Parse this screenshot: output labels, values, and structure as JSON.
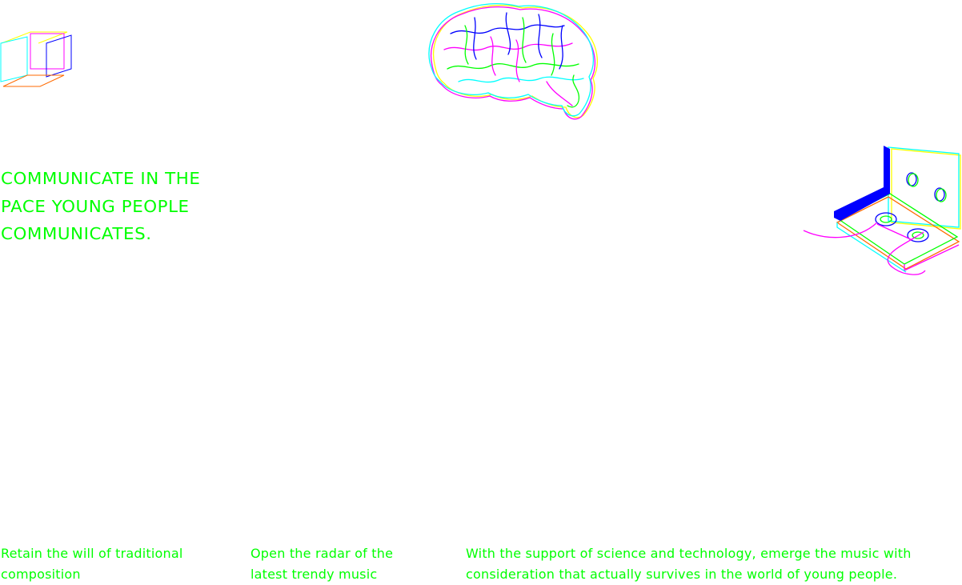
{
  "theme": {
    "accent": "#00ff00",
    "cyan": "#00ffff",
    "magenta": "#ff00ff",
    "yellow": "#ffff00",
    "blue": "#0000ff",
    "orange": "#ff6a00",
    "background": "#ffffff"
  },
  "illustrations": {
    "cube": "wireframe-cube-icon",
    "brain": "brain-illustration",
    "cassette": "cassette-tape-illustration"
  },
  "headline": {
    "lines": [
      "COMMUNICATE IN THE",
      "PACE YOUNG PEOPLE",
      "COMMUNICATES."
    ]
  },
  "features": [
    {
      "lines": [
        "Retain the will of traditional",
        "composition"
      ]
    },
    {
      "lines": [
        "Open the radar of the",
        "latest trendy music"
      ]
    },
    {
      "lines": [
        "With the support of science and technology, emerge the music with",
        "consideration that actually survives in the world of young people."
      ]
    }
  ]
}
